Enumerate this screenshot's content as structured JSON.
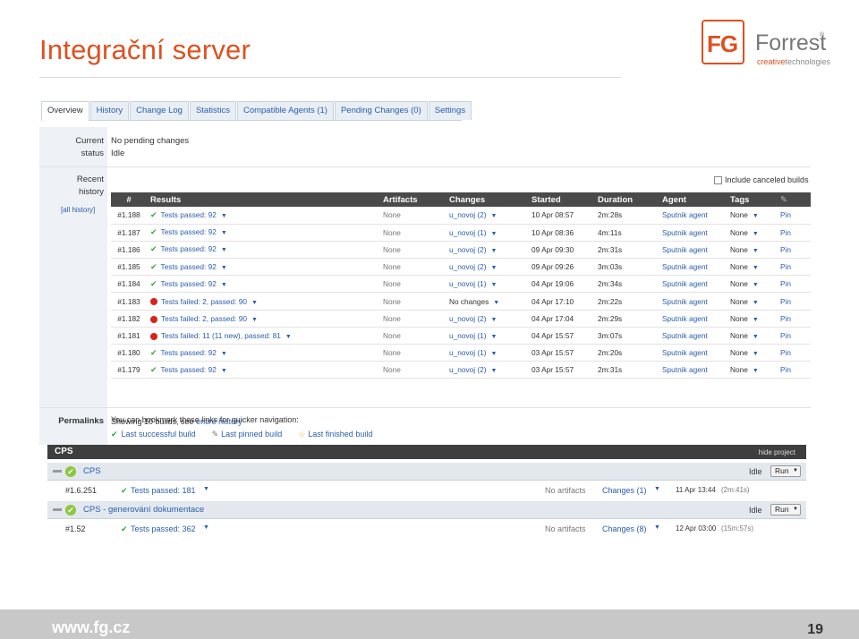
{
  "slide": {
    "title": "Integrační server",
    "footer_url": "www.fg.cz",
    "page_number": "19"
  },
  "logo": {
    "mark": "FG",
    "name": "Forrest",
    "reg": "®",
    "sub_highlight": "creative",
    "sub_rest": "technologies"
  },
  "tabs": [
    "Overview",
    "History",
    "Change Log",
    "Statistics",
    "Compatible Agents (1)",
    "Pending Changes (0)",
    "Settings"
  ],
  "current_status": {
    "label_1": "Current",
    "label_2": "status",
    "line_1": "No pending changes",
    "line_2": "Idle"
  },
  "recent_history": {
    "label_1": "Recent",
    "label_2": "history",
    "all_history": "[all history]",
    "include_canceled": "Include canceled builds"
  },
  "history_columns": [
    "#",
    "Results",
    "Artifacts",
    "Changes",
    "Started",
    "Duration",
    "Agent",
    "Tags",
    "Pin"
  ],
  "history_rows": [
    {
      "num": "#1.188",
      "ok": true,
      "result": "Tests passed: 92",
      "artifacts": "None",
      "changes": "u_novoj (2)",
      "started": "10 Apr 08:57",
      "duration": "2m:28s",
      "agent": "Sputnik agent",
      "tags": "None",
      "pin": "Pin"
    },
    {
      "num": "#1.187",
      "ok": true,
      "result": "Tests passed: 92",
      "artifacts": "None",
      "changes": "u_novoj (1)",
      "started": "10 Apr 08:36",
      "duration": "4m:11s",
      "agent": "Sputnik agent",
      "tags": "None",
      "pin": "Pin"
    },
    {
      "num": "#1.186",
      "ok": true,
      "result": "Tests passed: 92",
      "artifacts": "None",
      "changes": "u_novoj (2)",
      "started": "09 Apr 09:30",
      "duration": "2m:31s",
      "agent": "Sputnik agent",
      "tags": "None",
      "pin": "Pin"
    },
    {
      "num": "#1.185",
      "ok": true,
      "result": "Tests passed: 92",
      "artifacts": "None",
      "changes": "u_novoj (2)",
      "started": "09 Apr 09:26",
      "duration": "3m:03s",
      "agent": "Sputnik agent",
      "tags": "None",
      "pin": "Pin"
    },
    {
      "num": "#1.184",
      "ok": true,
      "result": "Tests passed: 92",
      "artifacts": "None",
      "changes": "u_novoj (1)",
      "started": "04 Apr 19:06",
      "duration": "2m:34s",
      "agent": "Sputnik agent",
      "tags": "None",
      "pin": "Pin"
    },
    {
      "num": "#1.183",
      "ok": false,
      "result": "Tests failed: 2, passed: 90",
      "artifacts": "None",
      "changes": "No changes",
      "started": "04 Apr 17:10",
      "duration": "2m:22s",
      "agent": "Sputnik agent",
      "tags": "None",
      "pin": "Pin"
    },
    {
      "num": "#1.182",
      "ok": false,
      "result": "Tests failed: 2, passed: 90",
      "artifacts": "None",
      "changes": "u_novoj (2)",
      "started": "04 Apr 17:04",
      "duration": "2m:29s",
      "agent": "Sputnik agent",
      "tags": "None",
      "pin": "Pin"
    },
    {
      "num": "#1.181",
      "ok": false,
      "result": "Tests failed: 11 (11 new), passed: 81",
      "artifacts": "None",
      "changes": "u_novoj (1)",
      "started": "04 Apr 15:57",
      "duration": "3m:07s",
      "agent": "Sputnik agent",
      "tags": "None",
      "pin": "Pin"
    },
    {
      "num": "#1.180",
      "ok": true,
      "result": "Tests passed: 92",
      "artifacts": "None",
      "changes": "u_novoj (1)",
      "started": "03 Apr 15:57",
      "duration": "2m:20s",
      "agent": "Sputnik agent",
      "tags": "None",
      "pin": "Pin"
    },
    {
      "num": "#1.179",
      "ok": true,
      "result": "Tests passed: 92",
      "artifacts": "None",
      "changes": "u_novoj (2)",
      "started": "03 Apr 15:57",
      "duration": "2m:31s",
      "agent": "Sputnik agent",
      "tags": "None",
      "pin": "Pin"
    }
  ],
  "showing": {
    "prefix": "Showing 10 builds, see",
    "link": "entire history"
  },
  "permalinks": {
    "label": "Permalinks",
    "intro": "You can bookmark these links for quicker navigation:",
    "last_successful": "Last successful build",
    "last_pinned": "Last pinned build",
    "last_finished": "Last finished build"
  },
  "project": {
    "name": "CPS",
    "hide": "hide project",
    "configs": [
      {
        "name": "CPS",
        "status": "Idle",
        "run": "Run",
        "build": "#1.6.251",
        "result": "Tests passed: 181",
        "artifacts": "No artifacts",
        "changes": "Changes (1)",
        "started": "11 Apr 13:44",
        "duration": "(2m:41s)"
      },
      {
        "name": "CPS - generování dokumentace",
        "status": "Idle",
        "run": "Run",
        "build": "#1.52",
        "result": "Tests passed: 362",
        "artifacts": "No artifacts",
        "changes": "Changes (8)",
        "started": "12 Apr 03:00",
        "duration": "(15m:57s)"
      }
    ]
  },
  "icons": {
    "check": "check-icon",
    "fail": "red-dot-icon",
    "dropdown": "triangle-down-icon",
    "pin": "pin-icon",
    "star": "star-icon"
  },
  "colors": {
    "accent": "#e0501e",
    "link": "#2a5db0",
    "ok": "#3aa835",
    "fail": "#d6231c"
  }
}
